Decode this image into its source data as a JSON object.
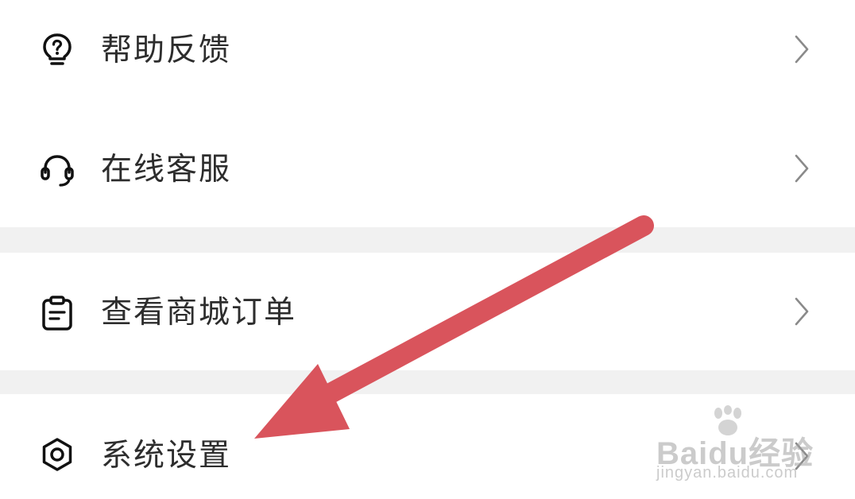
{
  "menu": {
    "items": [
      {
        "label": "帮助反馈",
        "icon": "help-bulb-icon"
      },
      {
        "label": "在线客服",
        "icon": "headset-icon"
      },
      {
        "label": "查看商城订单",
        "icon": "clipboard-icon"
      },
      {
        "label": "系统设置",
        "icon": "hexagon-settings-icon"
      }
    ],
    "chevron_icon": "chevron-right-icon"
  },
  "annotation": {
    "type": "arrow",
    "color": "#d9545c",
    "target": "系统设置"
  },
  "watermark": {
    "brand": "Baidu经验",
    "sub": "jingyan.baidu.com"
  },
  "colors": {
    "background": "#ffffff",
    "separator": "#f1f1f1",
    "text": "#2d2d2d",
    "chevron": "#8a8a8a",
    "arrow": "#d9545c"
  }
}
